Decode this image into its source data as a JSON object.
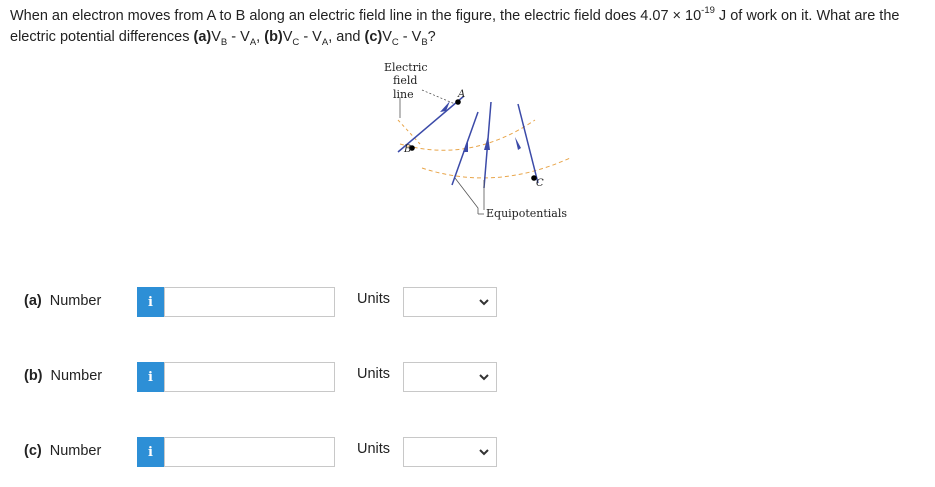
{
  "question": {
    "t1": "When an electron moves from A to B along an electric field line in the figure, the electric field does 4.07 × 10",
    "exp": "-19",
    "t2": " J of work on it. What are the electric potential differences ",
    "a_label": "(a)",
    "a_v1": "V",
    "a_s1": "B",
    "a_mid": " - V",
    "a_s2": "A",
    "sep1": ", ",
    "b_label": "(b)",
    "b_v1": "V",
    "b_s1": "C",
    "b_mid": " - V",
    "b_s2": "A",
    "sep2": ", and ",
    "c_label": "(c)",
    "c_v1": "V",
    "c_s1": "C",
    "c_mid": " - V",
    "c_s2": "B",
    "end": "?"
  },
  "figure": {
    "label_electric": "Electric",
    "label_field": "field",
    "label_line": "line",
    "point_a": "A",
    "point_b": "B",
    "point_c": "C",
    "label_equipotentials": "Equipotentials"
  },
  "rows": [
    {
      "part": "(a)",
      "label": "Number",
      "info": "i",
      "value": "",
      "units_label": "Units",
      "units_value": ""
    },
    {
      "part": "(b)",
      "label": "Number",
      "info": "i",
      "value": "",
      "units_label": "Units",
      "units_value": ""
    },
    {
      "part": "(c)",
      "label": "Number",
      "info": "i",
      "value": "",
      "units_label": "Units",
      "units_value": ""
    }
  ],
  "colors": {
    "info_button": "#2d8fd6",
    "field_line": "#3b4aa8",
    "equipotential": "#e8a54a"
  }
}
